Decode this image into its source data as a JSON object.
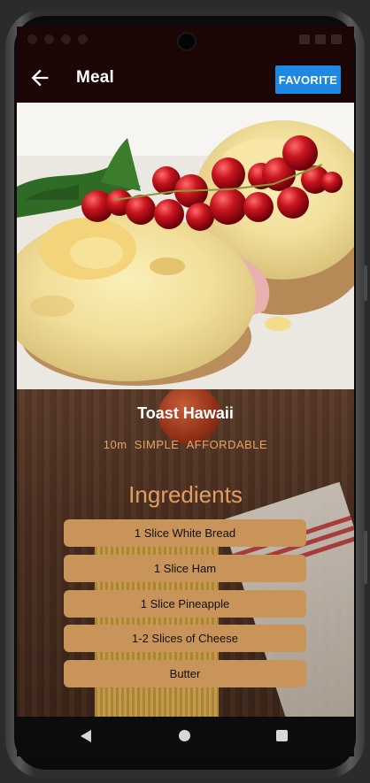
{
  "appbar": {
    "title": "Meal",
    "back_icon": "arrow-left-icon",
    "favorite_label": "FAVORITE",
    "favorite_color": "#1e88e5"
  },
  "meal": {
    "name": "Toast Hawaii",
    "duration": "10m",
    "complexity": "SIMPLE",
    "affordability": "AFFORDABLE"
  },
  "ingredients": {
    "heading": "Ingredients",
    "items": [
      "1 Slice White Bread",
      "1 Slice Ham",
      "1 Slice Pineapple",
      "1-2 Slices of Cheese",
      "Butter"
    ]
  },
  "colors": {
    "appbar_bg": "#1b0505",
    "ingredient_chip": "#c99459",
    "accent_text": "#e09e62"
  },
  "navbar": {
    "icons": [
      "back-triangle-icon",
      "home-circle-icon",
      "recents-square-icon"
    ]
  }
}
